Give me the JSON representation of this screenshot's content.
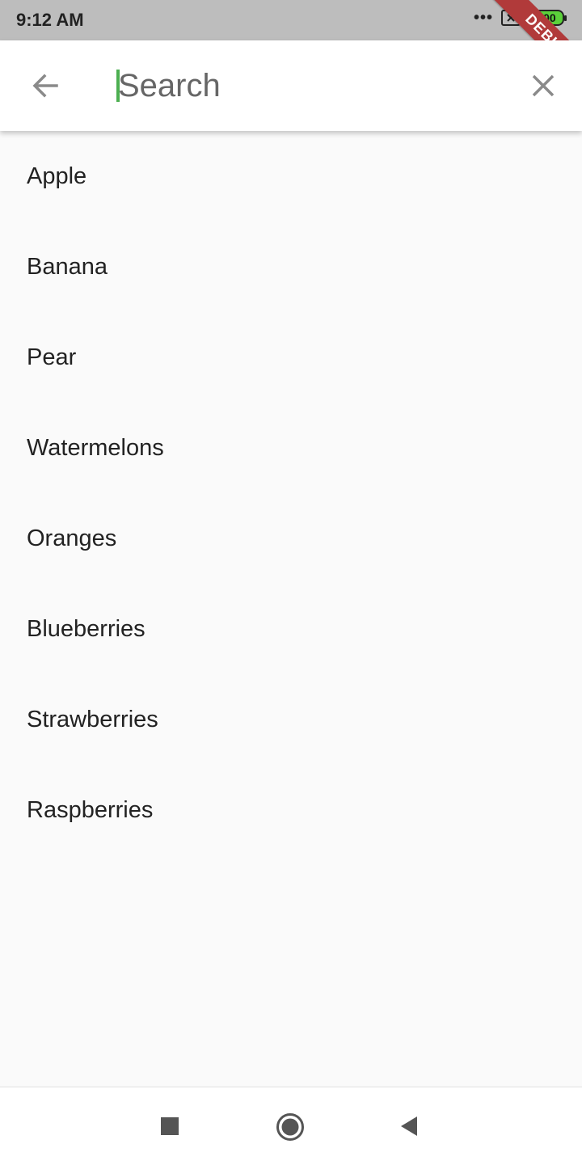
{
  "status_bar": {
    "time": "9:12 AM",
    "dots": "•••",
    "battery": "100",
    "debug_banner": "DEBUG"
  },
  "app_bar": {
    "search_placeholder": "Search",
    "search_value": ""
  },
  "list": {
    "items": [
      {
        "label": "Apple"
      },
      {
        "label": "Banana"
      },
      {
        "label": "Pear"
      },
      {
        "label": "Watermelons"
      },
      {
        "label": "Oranges"
      },
      {
        "label": "Blueberries"
      },
      {
        "label": "Strawberries"
      },
      {
        "label": "Raspberries"
      }
    ]
  },
  "colors": {
    "cursor": "#4caf50",
    "status_bar_bg": "#bdbdbd",
    "debug_banner": "#b13a3a",
    "battery_fill": "#5bd13a"
  },
  "icons": {
    "back": "arrow-back-icon",
    "clear": "close-icon",
    "nav_recents": "square-icon",
    "nav_home": "circle-icon",
    "nav_back": "triangle-back-icon"
  }
}
